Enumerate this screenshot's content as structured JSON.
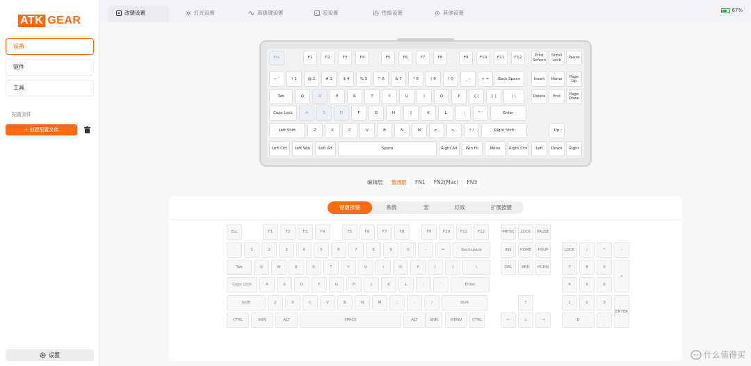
{
  "logo": {
    "left": "ATK",
    "right": "GEAR"
  },
  "sidebar": {
    "items": [
      "设备",
      "驱件",
      "工具"
    ],
    "profiles_label": "配置文件",
    "create_button": "创建配置文件",
    "settings_label": "设置"
  },
  "tabs": [
    "改键设置",
    "灯光设置",
    "高级键设置",
    "宏设置",
    "性能设置",
    "其他设置"
  ],
  "battery": {
    "percent": "67%",
    "level": 0.67
  },
  "layers": {
    "label": "编辑层",
    "items": [
      "普通层",
      "FN1",
      "FN2(Mac)",
      "FN3"
    ],
    "active": "普通层"
  },
  "subtabs": {
    "items": [
      "键盘按键",
      "系统",
      "宏",
      "灯效",
      "扩展按键"
    ],
    "active": "键盘按键"
  },
  "preview_keys": [
    [
      {
        "label": "Esc",
        "hl": true
      },
      {
        "label": "F1"
      },
      {
        "label": "F2"
      },
      {
        "label": "F3"
      },
      {
        "label": "F4"
      },
      {
        "label": "F5"
      },
      {
        "label": "F6"
      },
      {
        "label": "F7"
      },
      {
        "label": "F8"
      },
      {
        "label": "F9"
      },
      {
        "label": "F10"
      },
      {
        "label": "F11"
      },
      {
        "label": "F12"
      },
      {
        "label": "Print Screen"
      },
      {
        "label": "Scroll Lock"
      },
      {
        "label": "Pause"
      }
    ],
    [
      {
        "label": "~ `"
      },
      {
        "label": "! 1"
      },
      {
        "label": "@ 2"
      },
      {
        "label": "# 3"
      },
      {
        "label": "$ 4"
      },
      {
        "label": "% 5"
      },
      {
        "label": "^ 6"
      },
      {
        "label": "& 7"
      },
      {
        "label": "* 8"
      },
      {
        "label": "( 9"
      },
      {
        "label": ") 0"
      },
      {
        "label": "_ -"
      },
      {
        "label": "+ ="
      },
      {
        "label": "Back Space"
      },
      {
        "label": "Insert"
      },
      {
        "label": "Home"
      },
      {
        "label": "Page Up"
      }
    ],
    [
      {
        "label": "Tab"
      },
      {
        "label": "Q"
      },
      {
        "label": "W",
        "hl": true
      },
      {
        "label": "E"
      },
      {
        "label": "R"
      },
      {
        "label": "T"
      },
      {
        "label": "Y"
      },
      {
        "label": "U"
      },
      {
        "label": "I"
      },
      {
        "label": "O"
      },
      {
        "label": "P"
      },
      {
        "label": "{ ["
      },
      {
        "label": "} ]"
      },
      {
        "label": "| \\"
      },
      {
        "label": "Delete"
      },
      {
        "label": "End"
      },
      {
        "label": "Page Down"
      }
    ],
    [
      {
        "label": "Caps Lock"
      },
      {
        "label": "A",
        "hl": true
      },
      {
        "label": "S",
        "hl": true
      },
      {
        "label": "D",
        "hl": true
      },
      {
        "label": "F"
      },
      {
        "label": "G"
      },
      {
        "label": "H"
      },
      {
        "label": "J"
      },
      {
        "label": "K"
      },
      {
        "label": "L"
      },
      {
        "label": ": ;"
      },
      {
        "label": "\" '"
      },
      {
        "label": "Enter"
      }
    ],
    [
      {
        "label": "Left Shift"
      },
      {
        "label": "Z"
      },
      {
        "label": "X"
      },
      {
        "label": "C"
      },
      {
        "label": "V"
      },
      {
        "label": "B"
      },
      {
        "label": "N"
      },
      {
        "label": "M"
      },
      {
        "label": "< ,"
      },
      {
        "label": "> ."
      },
      {
        "label": "? /"
      },
      {
        "label": "Right Shift"
      },
      {
        "label": "Up"
      }
    ],
    [
      {
        "label": "Left Ctrl"
      },
      {
        "label": "Left Win"
      },
      {
        "label": "Left Alt"
      },
      {
        "label": "Space"
      },
      {
        "label": "Right Alt"
      },
      {
        "label": "Win Fn"
      },
      {
        "label": "Menu"
      },
      {
        "label": "Right Ctrl"
      },
      {
        "label": "Left"
      },
      {
        "label": "Down"
      },
      {
        "label": "Right"
      }
    ]
  ],
  "grid_keys": [
    [
      "Esc",
      "F1",
      "F2",
      "F3",
      "F4",
      "F5",
      "F6",
      "F7",
      "F8",
      "F9",
      "F10",
      "F11",
      "F12",
      "PRTSC",
      "LOCK",
      "PAUSE"
    ],
    [
      "`",
      "1",
      "2",
      "3",
      "4",
      "5",
      "6",
      "7",
      "8",
      "9",
      "0",
      "-",
      "=",
      "Backspace",
      "INS",
      "HOME",
      "PGUP",
      "LOCK",
      "/",
      "*",
      "-"
    ],
    [
      "Tab",
      "Q",
      "W",
      "E",
      "R",
      "T",
      "Y",
      "U",
      "I",
      "O",
      "P",
      "[",
      "]",
      "\\",
      "DEL",
      "END",
      "PGDN",
      "7",
      "8",
      "9",
      "+"
    ],
    [
      "Caps Lock",
      "A",
      "S",
      "D",
      "F",
      "G",
      "H",
      "J",
      "K",
      "L",
      ";",
      "'",
      "Enter",
      "4",
      "5",
      "6"
    ],
    [
      "Shift",
      "Z",
      "X",
      "C",
      "V",
      "B",
      "N",
      "M",
      ",",
      ".",
      "/",
      "Shift",
      "↑",
      "1",
      "2",
      "3",
      "ENTER"
    ],
    [
      "CTRL",
      "WIN",
      "ALT",
      "SPACE",
      "ALT",
      "WIN",
      "MENU",
      "CTRL",
      "←",
      "↓",
      "→",
      "0",
      "."
    ]
  ],
  "watermark": "什么值得买"
}
